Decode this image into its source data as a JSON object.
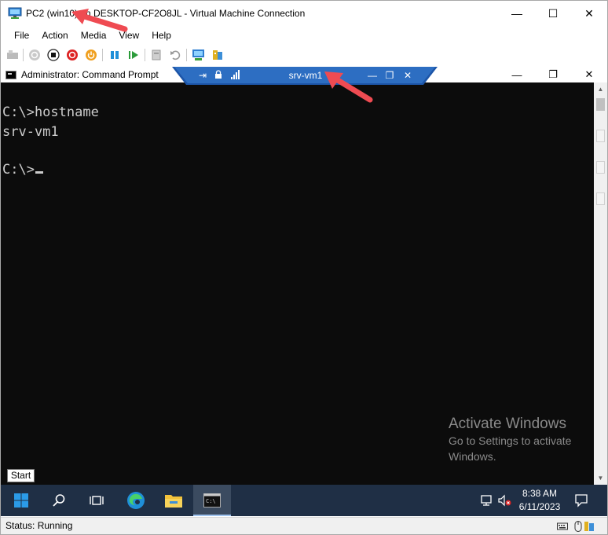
{
  "window": {
    "title": "PC2 (win10) on DESKTOP-CF2O8JL - Virtual Machine Connection",
    "minimize_glyph": "—",
    "maximize_glyph": "☐",
    "close_glyph": "✕"
  },
  "menu": [
    "File",
    "Action",
    "Media",
    "View",
    "Help"
  ],
  "toolbar": {
    "icons": [
      "ctrl-alt-del-icon",
      "start-icon",
      "turn-off-icon",
      "shut-down-icon",
      "power-icon",
      "pause-icon",
      "resume-icon",
      "checkpoint-icon",
      "revert-icon",
      "enhanced-session-icon",
      "share-icon"
    ]
  },
  "cmd": {
    "title": "Administrator: Command Prompt",
    "lines": [
      "C:\\>hostname",
      "srv-vm1",
      "",
      "C:\\>"
    ],
    "minimize_glyph": "—",
    "maximize_glyph": "❐",
    "close_glyph": "✕"
  },
  "connection_bar": {
    "title": "srv-vm1",
    "pin_glyph": "⇥",
    "lock_glyph": "🔒",
    "minimize_glyph": "—",
    "restore_glyph": "❐",
    "close_glyph": "✕"
  },
  "watermark": {
    "title": "Activate Windows",
    "line1": "Go to Settings to activate",
    "line2": "Windows."
  },
  "start_tooltip": "Start",
  "taskbar": {
    "time": "8:38 AM",
    "date": "6/11/2023"
  },
  "status": {
    "text": "Status: Running"
  },
  "colors": {
    "taskbar": "#1f2f45",
    "console_bg": "#0c0c0c",
    "console_text": "#cccccc",
    "connection_bar": "#1c55a8",
    "annotation_arrow": "#ef4b52"
  }
}
